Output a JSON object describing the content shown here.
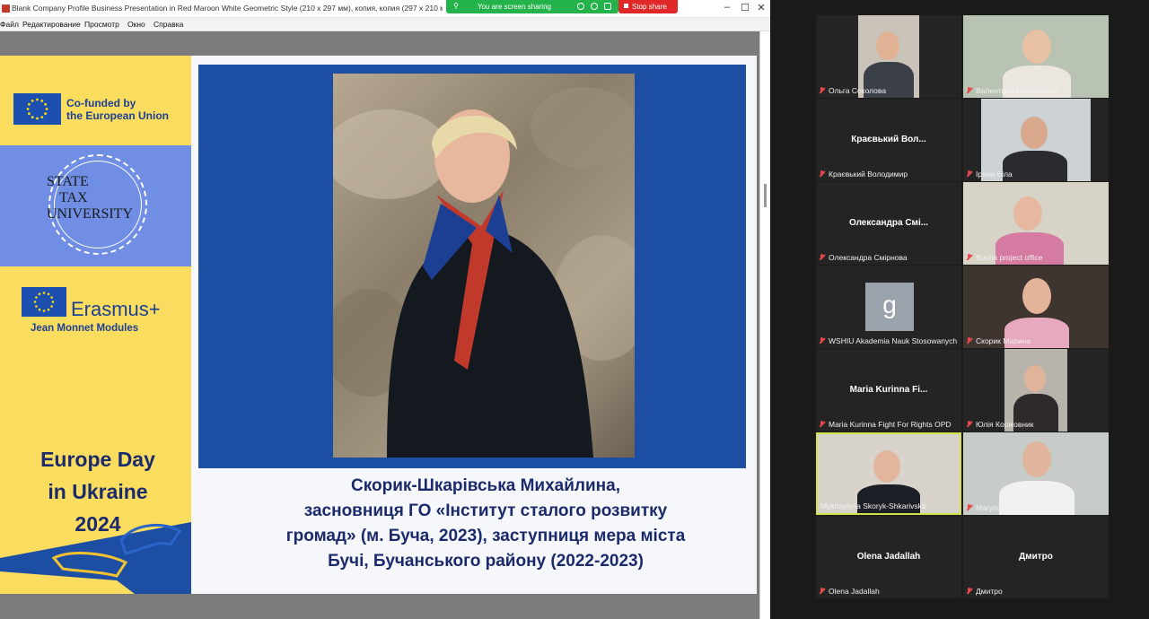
{
  "window": {
    "title": "Blank Company Profile Business Presentation in Red Maroon White Geometric Style (210 x 297 мм), копия, копия (297 x 210 мм), копия",
    "sharing_text": "You are screen sharing",
    "stop_share": "Stop share"
  },
  "menu": [
    "Файл",
    "Редактирование",
    "Просмотр",
    "Окно",
    "Справка"
  ],
  "slide": {
    "cofunded": [
      "Co-funded by",
      "the European Union"
    ],
    "seal_text": [
      "STATE",
      "TAX",
      "UNIVERSITY"
    ],
    "erasmus": "Erasmus+",
    "jean_monnet": "Jean Monnet Modules",
    "europe_day": [
      "Europe Day",
      "in Ukraine",
      "2024"
    ],
    "caption": [
      "Скорик-Шкарівська Михайлина,",
      "засновниця ГО «Інститут сталого розвитку",
      "громад» (м. Буча, 2023), заступниця мера міста",
      "Бучі, Бучанського району (2022-2023)"
    ]
  },
  "participants": [
    {
      "name": "Ольга Соколова",
      "big": "",
      "video": true
    },
    {
      "name": "Валентина Мартиненко",
      "big": "",
      "video": true
    },
    {
      "name": "Краєвький Володимир",
      "big": "Краєвький  Вол...",
      "video": false
    },
    {
      "name": "Ірина Біла",
      "big": "",
      "video": true
    },
    {
      "name": "Олександра Смірнова",
      "big": "Олександра  Смі...",
      "video": false
    },
    {
      "name": "Bucha project office",
      "big": "",
      "video": true
    },
    {
      "name": "WSHIU Akademia Nauk Stosowanych",
      "big": "g",
      "video": false
    },
    {
      "name": "Скорик Марина",
      "big": "",
      "video": true
    },
    {
      "name": "Maria Kurinna Fight For Rights OPD",
      "big": "Maria  Kurinna  Fi...",
      "video": false
    },
    {
      "name": "Юлія Коржовник",
      "big": "",
      "video": true
    },
    {
      "name": "Mykhaylyna Skoryk-Shkarivska",
      "big": "",
      "video": true
    },
    {
      "name": "Maryna Korzh",
      "big": "",
      "video": true
    },
    {
      "name": "Olena Jadallah",
      "big": "Olena  Jadallah",
      "video": false
    },
    {
      "name": "Дмитро",
      "big": "Дмитро",
      "video": false
    }
  ],
  "colors": {
    "share_green": "#24b24a",
    "stop_red": "#e02828",
    "slide_yellow": "#fadd5f",
    "slide_blue": "#1c4fa3",
    "text_navy": "#1b2a6b",
    "active_border": "#d6e14a"
  }
}
